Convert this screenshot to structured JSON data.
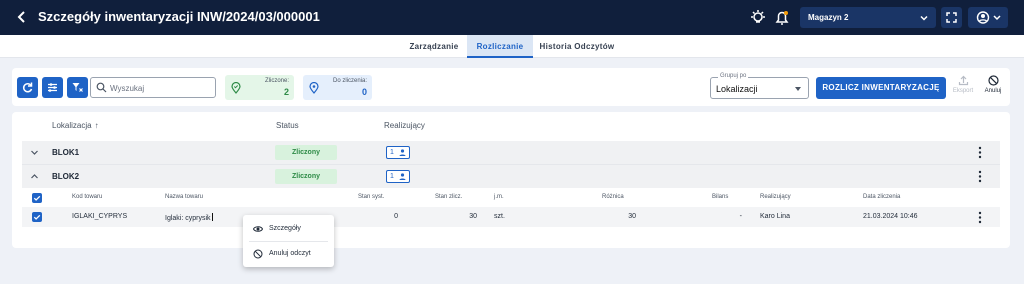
{
  "header": {
    "title": "Szczegóły inwentaryzacji INW/2024/03/000001",
    "warehouse": "Magazyn 2"
  },
  "tabs": [
    {
      "label": "Zarządzanie"
    },
    {
      "label": "Rozliczanie",
      "active": true
    },
    {
      "label": "Historia Odczytów"
    }
  ],
  "toolbar": {
    "search_placeholder": "Wyszukaj",
    "counted_label": "Zliczone:",
    "counted_value": "2",
    "to_settle_label": "Do zliczenia:",
    "to_settle_value": "0",
    "group_by_legend": "Grupuj po",
    "group_by_value": "Lokalizacji",
    "settle_button": "ROZLICZ INWENTARYZACJĘ",
    "export_label": "Eksport",
    "cancel_label": "Anuluj"
  },
  "table": {
    "headers": {
      "location": "Lokalizacja",
      "status": "Status",
      "assignee": "Realizujący"
    },
    "groups": [
      {
        "name": "BLOK1",
        "status": "Zliczony",
        "users": "1"
      },
      {
        "name": "BLOK2",
        "status": "Zliczony",
        "users": "1"
      }
    ],
    "sub_headers": {
      "code": "Kod towaru",
      "name": "Nazwa towaru",
      "system_stock": "Stan syst.",
      "counted_stock": "Stan zlicz.",
      "unit": "j.m.",
      "difference": "Różnica",
      "balance": "Bilans",
      "assignee": "Realizujący",
      "date": "Data zliczenia"
    },
    "rows": [
      {
        "code": "IGLAKI_CYPRYS",
        "name": "Iglaki: cyprysik",
        "system_stock": "0",
        "counted_stock": "30",
        "unit": "szt.",
        "difference": "30",
        "balance": "-",
        "assignee": "Karo Lina",
        "date": "21.03.2024 10:46"
      }
    ]
  },
  "context_menu": {
    "details": "Szczegóły",
    "cancel_read": "Anuluj odczyt"
  },
  "colors": {
    "topbar": "#101f3c",
    "accent": "#1f63c6",
    "success": "#2e8b47"
  }
}
